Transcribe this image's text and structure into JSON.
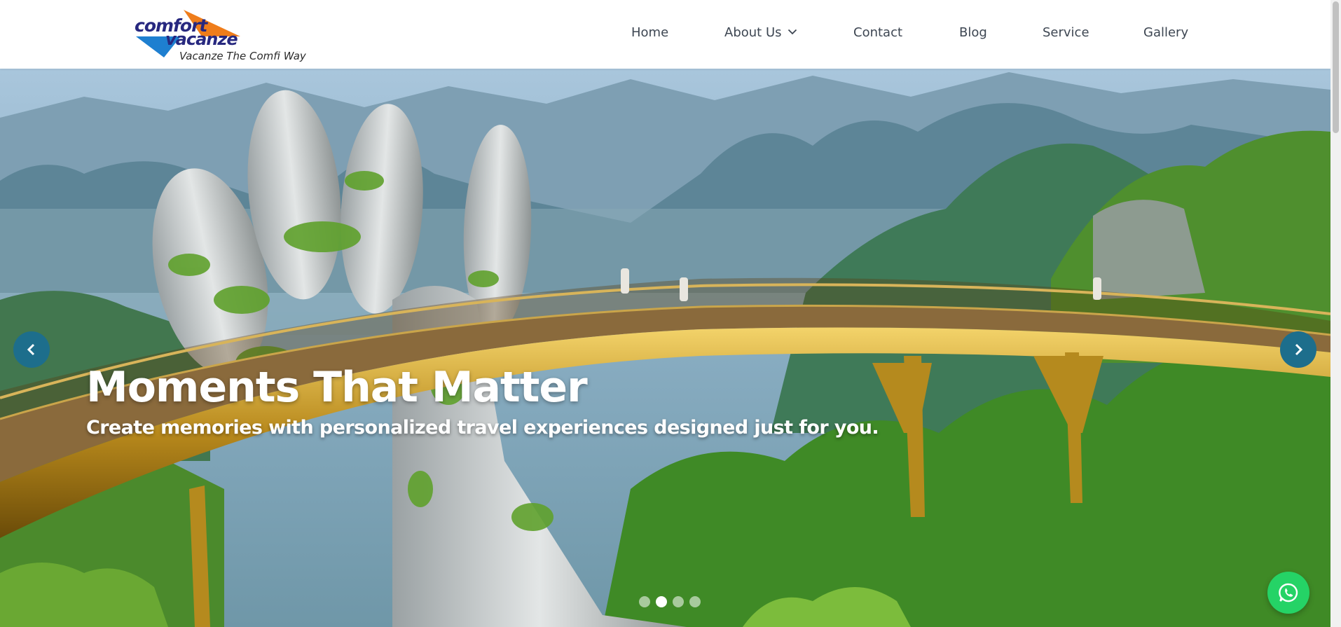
{
  "brand": {
    "name_line1": "comfort",
    "name_line2": "vacanze",
    "tagline": "Vacanze The Comfi Way",
    "colors": {
      "navy": "#27287f",
      "orange": "#ef7d1b",
      "blue": "#1e7fd0"
    }
  },
  "nav": {
    "items": [
      {
        "label": "Home",
        "icon": ""
      },
      {
        "label": "About Us",
        "icon": "chevron-down-icon"
      },
      {
        "label": "Contact",
        "icon": ""
      },
      {
        "label": "Blog",
        "icon": ""
      },
      {
        "label": "Service",
        "icon": ""
      },
      {
        "label": "Gallery",
        "icon": ""
      }
    ]
  },
  "hero": {
    "title": "Moments That Matter",
    "subtitle": "Create memories with personalized travel experiences designed just for you.",
    "prev_icon": "chevron-left-icon",
    "next_icon": "chevron-right-icon",
    "arrow_color": "#1d6e8c",
    "slide_count": 4,
    "active_slide": 2,
    "image_subject": "golden-bridge-stone-hands"
  },
  "whatsapp": {
    "icon": "whatsapp-icon",
    "color": "#25d366"
  }
}
